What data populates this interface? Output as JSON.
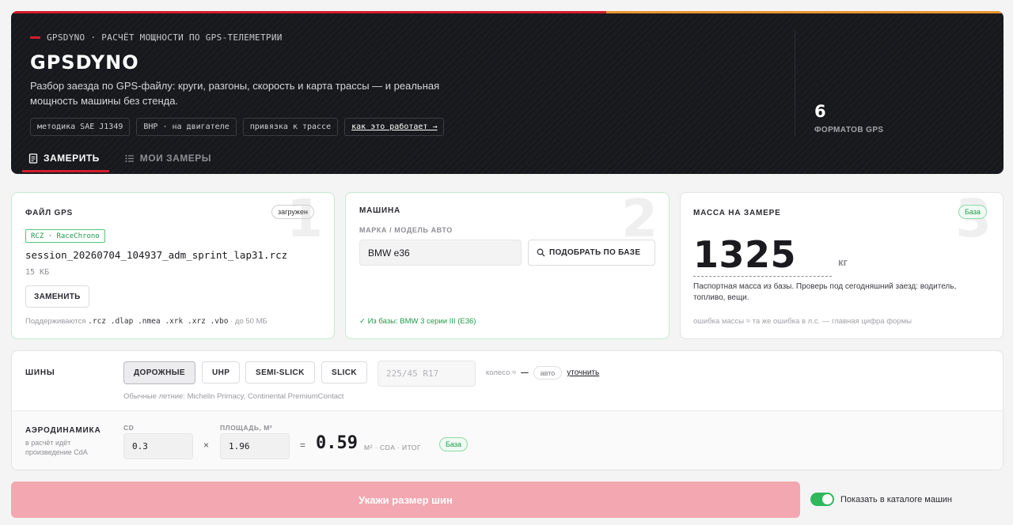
{
  "hero": {
    "kicker": "GPSDYNO · РАСЧЁТ МОЩНОСТИ ПО GPS-ТЕЛЕМЕТРИИ",
    "title": "GPSDYNO",
    "description": "Разбор заезда по GPS-файлу: круги, разгоны, скорость и карта трассы — и реальная мощность машины без стенда.",
    "chips": [
      "методика SAE J1349",
      "BHP · на двигателе",
      "привязка к трассе"
    ],
    "how_link": "как это работает →",
    "stat_value": "6",
    "stat_label": "ФОРМАТОВ GPS",
    "tabs": [
      {
        "label": "ЗАМЕРИТЬ",
        "icon": "document-icon",
        "active": true
      },
      {
        "label": "МОИ ЗАМЕРЫ",
        "icon": "list-icon",
        "active": false
      }
    ],
    "accent_red": "#d41c2a",
    "accent_orange": "#e99530"
  },
  "file_card": {
    "label": "ФАЙЛ GPS",
    "step": "1",
    "status": "загружен",
    "format_tag": "RCZ · RaceChrono",
    "filename": "session_20260704_104937_adm_sprint_lap31.rcz",
    "filesize": "15 КБ",
    "replace_label": "ЗАМЕНИТЬ",
    "supported_prefix": "Поддерживаются",
    "supported_formats": ".rcz .dlap .nmea .xrk .xrz .vbo",
    "supported_suffix": "· до 50 МБ"
  },
  "car_card": {
    "label": "МАШИНА",
    "step": "2",
    "sublabel": "МАРКА / МОДЕЛЬ АВТО",
    "value": "BMW e36",
    "search_button": "ПОДОБРАТЬ ПО БАЗЕ",
    "match": "✓ Из базы: BMW 3 серии III (E36)"
  },
  "mass_card": {
    "label": "МАССА НА ЗАМЕРЕ",
    "step": "3",
    "badge": "База",
    "value": "1325",
    "unit": "кг",
    "note": "Паспортная масса из базы. Проверь под сегодняшний заезд: водитель, топливо, вещи.",
    "hint": "ошибка массы ≈ та же ошибка в л.с. — главная цифра формы"
  },
  "tires": {
    "label": "ШИНЫ",
    "options": [
      "ДОРОЖНЫЕ",
      "UHP",
      "SEMI-SLICK",
      "SLICK"
    ],
    "selected": "ДОРОЖНЫЕ",
    "size_placeholder": "225/45 R17",
    "wheel_label": "колесо ≈",
    "wheel_value": "—",
    "auto_label": "авто",
    "refine_label": "уточнить",
    "hint": "Обычные летние: Michelin Primacy, Continental PremiumContact"
  },
  "aero": {
    "label": "АЭРОДИНАМИКА",
    "sub": "в расчёт идёт произведение CdA",
    "cd_label": "CD",
    "cd_value": "0.3",
    "area_label": "ПЛОЩАДЬ, М²",
    "area_value": "1.96",
    "times": "×",
    "equals": "=",
    "cda_value": "0.59",
    "cda_unit": "М² · CDA · ИТОГ",
    "badge": "База"
  },
  "footer": {
    "cta": "Укажи размер шин",
    "catalog_toggle": "Показать в каталоге машин",
    "catalog_on": true
  }
}
